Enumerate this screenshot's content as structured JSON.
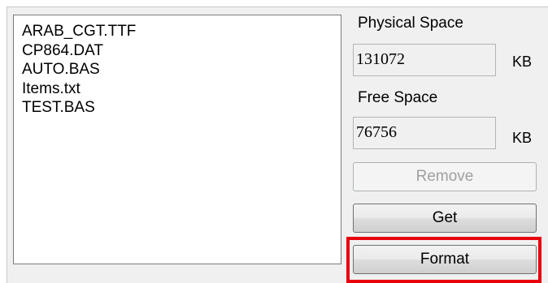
{
  "files": [
    "ARAB_CGT.TTF",
    "CP864.DAT",
    "AUTO.BAS",
    "Items.txt",
    "TEST.BAS"
  ],
  "physical_space": {
    "label": "Physical Space",
    "value": "131072",
    "unit": "KB"
  },
  "free_space": {
    "label": "Free Space",
    "value": "76756",
    "unit": "KB"
  },
  "buttons": {
    "remove_label": "Remove",
    "get_label": "Get",
    "format_label": "Format"
  },
  "colors": {
    "highlight": "#e8000d"
  }
}
